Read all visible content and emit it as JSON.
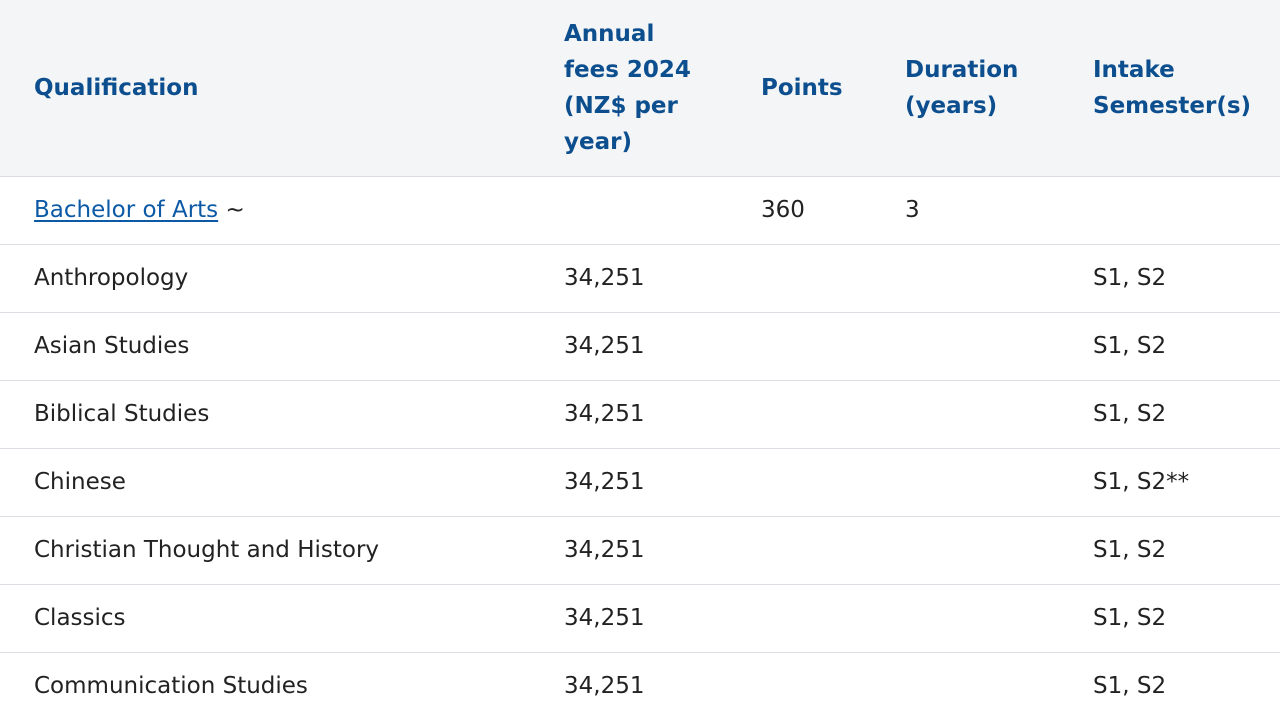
{
  "table": {
    "headers": {
      "qualification": "Qualification",
      "fees": "Annual fees 2024 (NZ$ per year)",
      "points": "Points",
      "duration": "Duration (years)",
      "intake": "Intake Semester(s)"
    },
    "programme": {
      "name": "Bachelor of Arts",
      "suffix": " ~",
      "points": "360",
      "duration": "3"
    },
    "rows": [
      {
        "subject": "Anthropology",
        "fee": "34,251",
        "intake": "S1, S2"
      },
      {
        "subject": "Asian Studies",
        "fee": "34,251",
        "intake": "S1, S2"
      },
      {
        "subject": "Biblical Studies",
        "fee": "34,251",
        "intake": "S1, S2"
      },
      {
        "subject": "Chinese",
        "fee": "34,251",
        "intake": "S1, S2**"
      },
      {
        "subject": "Christian Thought and History",
        "fee": "34,251",
        "intake": "S1, S2"
      },
      {
        "subject": "Classics",
        "fee": "34,251",
        "intake": "S1, S2"
      },
      {
        "subject": "Communication Studies",
        "fee": "34,251",
        "intake": "S1, S2"
      }
    ]
  },
  "colors": {
    "header_text": "#0c4e8e",
    "header_bg": "#f3f5f7",
    "link": "#0c5aa6",
    "body_text": "#222222"
  }
}
